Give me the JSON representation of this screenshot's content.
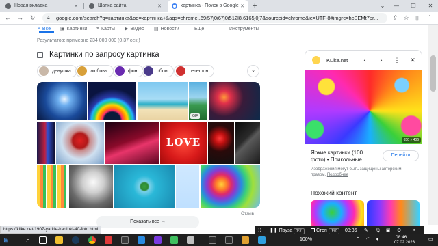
{
  "browser": {
    "tabs": [
      {
        "label": "Новая вкладка",
        "active": false
      },
      {
        "label": "Шапка сайта",
        "active": false
      },
      {
        "label": "картинка - Поиск в Google",
        "active": true
      }
    ],
    "new_tab": "+",
    "url": "google.com/search?q=картинка&oq=картинка+&aqs=chrome..69i57j0i67j0i512l8.6165j0j7&sourceid=chrome&ie=UTF-8#imgrc=hcSEMt7pr..."
  },
  "search_nav": {
    "items": [
      {
        "label": "Все",
        "icon": "search-icon"
      },
      {
        "label": "Картинки",
        "icon": "image-icon"
      },
      {
        "label": "Карты",
        "icon": "map-pin-icon"
      },
      {
        "label": "Видео",
        "icon": "play-icon"
      },
      {
        "label": "Новости",
        "icon": "news-icon"
      },
      {
        "label": "Ещё",
        "icon": "more-vert-icon"
      }
    ],
    "tools": "Инструменты",
    "active": "Все"
  },
  "results_stats": "Результатов: примерно 234 000 000 (0,37 сек.)",
  "images_heading": "Картинки по запросу картинка",
  "chips": [
    {
      "label": "девушка",
      "color": "#c9b8a8"
    },
    {
      "label": "любовь",
      "color": "#d8a03a"
    },
    {
      "label": "фон",
      "color": "#6a2bb0"
    },
    {
      "label": "обои",
      "color": "#4a3a8a"
    },
    {
      "label": "телефон",
      "color": "#d03030"
    }
  ],
  "grid": {
    "gif_badge": "GIF",
    "love_text": "LOVE"
  },
  "feedback": "Отзыв",
  "show_all": "Показать все",
  "side_panel": {
    "site": "KLike.net",
    "image_size": "650 × 406",
    "title": "Яркие картинки (100 фото) • Прикольные...",
    "visit": "Перейти",
    "copyright": "Изображения могут быть защищены авторским правом.",
    "more": "Подробнее",
    "similar": "Похожий контент"
  },
  "status_url": "https://klike.net/1907-yarkie-kartinki-40-foto.html",
  "media_bar": {
    "pause": "Пауза",
    "pause_key": "(F9)",
    "stop": "Стоп",
    "stop_key": "(F8)",
    "time": "08:36",
    "zoom": "100%"
  },
  "taskbar": {
    "time": "08:46",
    "date": "07.02.2023"
  }
}
